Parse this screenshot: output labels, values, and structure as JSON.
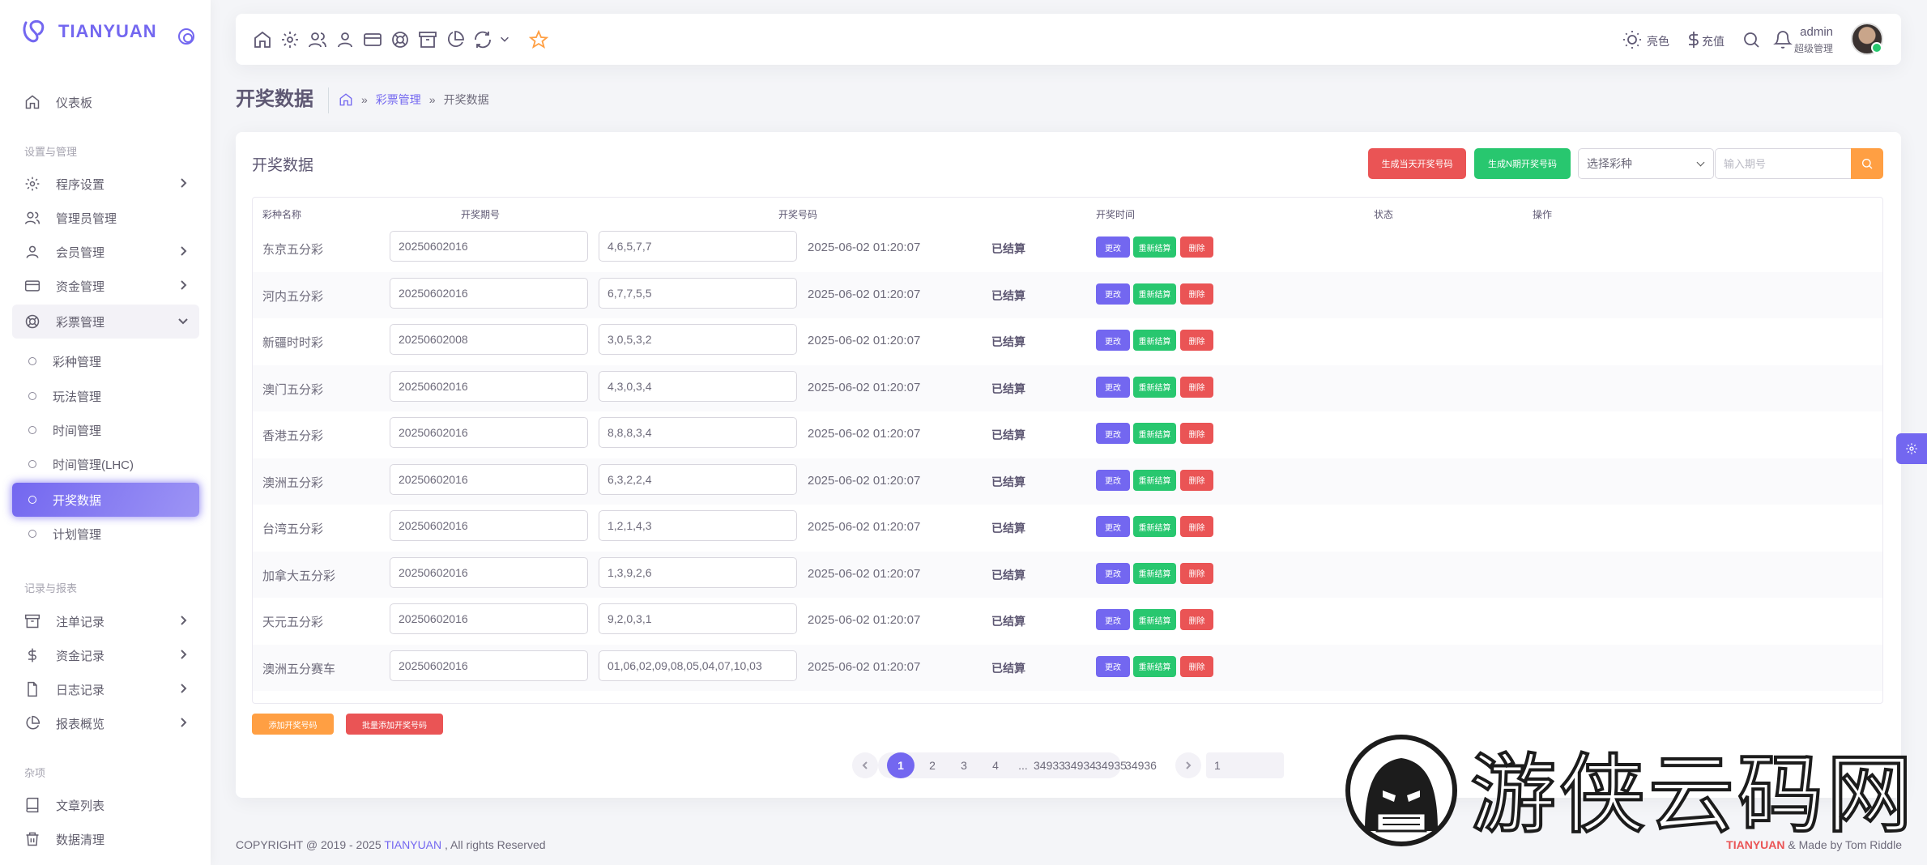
{
  "brand": {
    "name": "TIANYUAN",
    "accent": "#7367f0"
  },
  "sidebar": {
    "dashboard": "仪表板",
    "section_settings": "设置与管理",
    "items_settings": [
      {
        "label": "程序设置",
        "icon": "gear-icon"
      },
      {
        "label": "管理员管理",
        "icon": "users-icon"
      },
      {
        "label": "会员管理",
        "icon": "user-icon"
      },
      {
        "label": "资金管理",
        "icon": "credit-card-icon"
      },
      {
        "label": "彩票管理",
        "icon": "lifebuoy-icon"
      }
    ],
    "lottery_sub": [
      "彩种管理",
      "玩法管理",
      "时间管理",
      "时间管理(LHC)",
      "开奖数据",
      "计划管理"
    ],
    "section_records": "记录与报表",
    "items_records": [
      {
        "label": "注单记录",
        "icon": "archive-icon"
      },
      {
        "label": "资金记录",
        "icon": "dollar-icon"
      },
      {
        "label": "日志记录",
        "icon": "file-icon"
      },
      {
        "label": "报表概览",
        "icon": "pie-chart-icon"
      }
    ],
    "section_misc": "杂项",
    "items_misc": [
      {
        "label": "文章列表",
        "icon": "book-icon"
      },
      {
        "label": "数据清理",
        "icon": "trash-icon"
      }
    ]
  },
  "topbar": {
    "theme_label": "亮色",
    "recharge_label": "充值",
    "user_name": "admin",
    "user_role": "超级管理"
  },
  "breadcrumb": {
    "title": "开奖数据",
    "parent": "彩票管理",
    "current": "开奖数据"
  },
  "card": {
    "title": "开奖数据",
    "btn_gen_today": "生成当天开奖号码",
    "btn_gen_n_days": "生成N期开奖号码",
    "select_type": "选择彩种",
    "issue_placeholder": "输入期号",
    "btn_add": "添加开奖号码",
    "btn_batch_add": "批量添加开奖号码"
  },
  "table": {
    "headers": [
      "彩种名称",
      "开奖期号",
      "开奖号码",
      "开奖时间",
      "状态",
      "操作"
    ],
    "action_labels": {
      "edit": "更改",
      "resettle": "重新结算",
      "delete": "删除"
    },
    "rows": [
      {
        "name": "东京五分彩",
        "issue": "20250602016",
        "numbers": "4,6,5,7,7",
        "time": "2025-06-02 01:20:07",
        "status": "已结算"
      },
      {
        "name": "河内五分彩",
        "issue": "20250602016",
        "numbers": "6,7,7,5,5",
        "time": "2025-06-02 01:20:07",
        "status": "已结算"
      },
      {
        "name": "新疆时时彩",
        "issue": "20250602008",
        "numbers": "3,0,5,3,2",
        "time": "2025-06-02 01:20:07",
        "status": "已结算"
      },
      {
        "name": "澳门五分彩",
        "issue": "20250602016",
        "numbers": "4,3,0,3,4",
        "time": "2025-06-02 01:20:07",
        "status": "已结算"
      },
      {
        "name": "香港五分彩",
        "issue": "20250602016",
        "numbers": "8,8,8,3,4",
        "time": "2025-06-02 01:20:07",
        "status": "已结算"
      },
      {
        "name": "澳洲五分彩",
        "issue": "20250602016",
        "numbers": "6,3,2,2,4",
        "time": "2025-06-02 01:20:07",
        "status": "已结算"
      },
      {
        "name": "台湾五分彩",
        "issue": "20250602016",
        "numbers": "1,2,1,4,3",
        "time": "2025-06-02 01:20:07",
        "status": "已结算"
      },
      {
        "name": "加拿大五分彩",
        "issue": "20250602016",
        "numbers": "1,3,9,2,6",
        "time": "2025-06-02 01:20:07",
        "status": "已结算"
      },
      {
        "name": "天元五分彩",
        "issue": "20250602016",
        "numbers": "9,2,0,3,1",
        "time": "2025-06-02 01:20:07",
        "status": "已结算"
      },
      {
        "name": "澳洲五分赛车",
        "issue": "20250602016",
        "numbers": "01,06,02,09,08,05,04,07,10,03",
        "time": "2025-06-02 01:20:07",
        "status": "已结算"
      }
    ]
  },
  "pagination": {
    "pages": [
      "1",
      "2",
      "3",
      "4",
      "...",
      "34933",
      "34934",
      "34935",
      "34936"
    ],
    "current": "1",
    "goto_value": "1"
  },
  "footer": {
    "copyright_prefix": "COPYRIGHT @ 2019 - 2025 ",
    "copyright_brand": "TIANYUAN",
    "copyright_suffix": " , All rights Reserved",
    "right_brand": "TIANYUAN",
    "right_suffix": " & Made by Tom Riddle"
  },
  "watermark": {
    "text": "游侠云码网"
  },
  "colors": {
    "primary": "#7367f0",
    "success": "#28c76f",
    "danger": "#ea5455",
    "warning": "#ff9f43"
  }
}
